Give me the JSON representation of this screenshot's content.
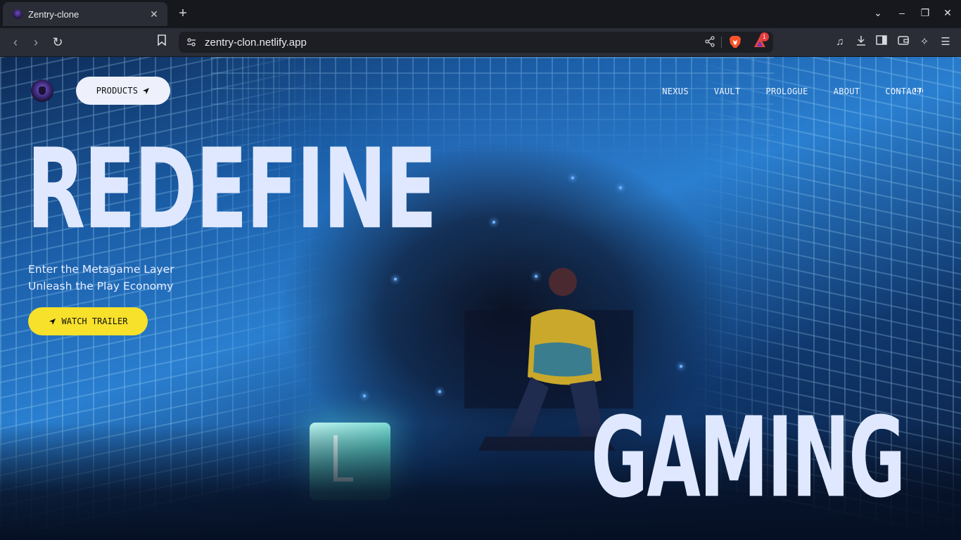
{
  "browser": {
    "tab_title": "Zentry-clone",
    "tab_close": "✕",
    "new_tab": "+",
    "url": "zentry-clon.netlify.app",
    "rewards_badge": "1",
    "window_controls": {
      "tabs_menu": "⌄",
      "minimize": "–",
      "restore": "❐",
      "close": "✕"
    },
    "nav": {
      "back": "‹",
      "forward": "›",
      "reload": "↻",
      "bookmark": "⚑"
    }
  },
  "page": {
    "products_label": "PRODUCTS",
    "nav_links": [
      "NEXUS",
      "VAULT",
      "PROLOGUE",
      "ABOUT",
      "CONTACT"
    ],
    "hero_top_word": "REDEFINE",
    "hero_bottom_word": "GAMING",
    "tagline_line1": "Enter the Metagame Layer",
    "tagline_line2": "Unleash the Play Economy",
    "watch_trailer_label": "WATCH TRAILER",
    "colors": {
      "accent_yellow": "#f7e12b",
      "hero_text": "#dfe8ff",
      "products_button": "#eef0fb"
    }
  }
}
